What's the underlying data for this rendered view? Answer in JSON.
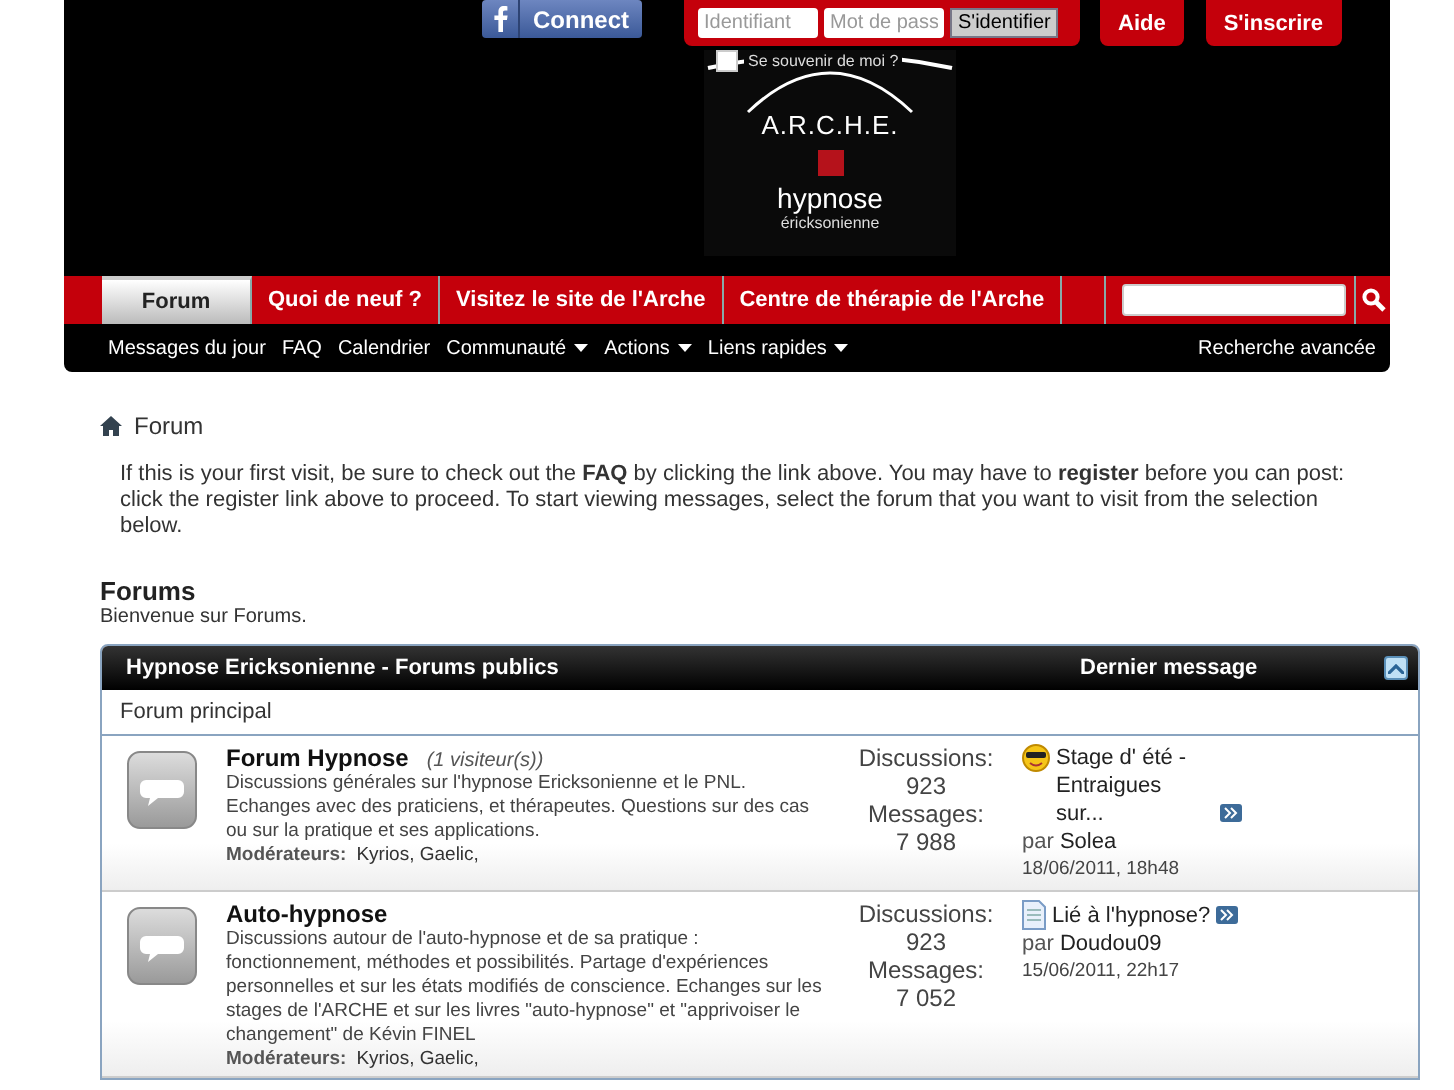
{
  "header": {
    "facebook_button": "Connect",
    "login": {
      "username_placeholder": "Identifiant",
      "password_placeholder": "Mot de pass",
      "submit": "S'identifier",
      "remember_label": "Se souvenir de moi ?",
      "remember_checked": false
    },
    "buttons": [
      "Aide",
      "S'inscrire"
    ],
    "logo": {
      "title": "A.R.C.H.E.",
      "line_1": "hypnose",
      "line_2": "éricksonienne"
    }
  },
  "nav_tabs": [
    {
      "label": "Forum",
      "selected": true
    },
    {
      "label": "Quoi de neuf ?",
      "selected": false
    },
    {
      "label": "Visitez le site de l'Arche",
      "selected": false
    },
    {
      "label": "Centre de thérapie de l'Arche",
      "selected": false
    }
  ],
  "sub_nav": [
    {
      "label": "Messages du jour",
      "dropdown": false
    },
    {
      "label": "FAQ",
      "dropdown": false
    },
    {
      "label": "Calendrier",
      "dropdown": false
    },
    {
      "label": "Communauté",
      "dropdown": true
    },
    {
      "label": "Actions",
      "dropdown": true
    },
    {
      "label": "Liens rapides",
      "dropdown": true
    }
  ],
  "advanced_search": "Recherche avancée",
  "breadcrumb": "Forum",
  "notice": "If this is your first visit, be sure to check out the **FAQ** by clicking the link above. You may have to **register** before you can post: click the register link above to proceed. To start viewing messages, select the forum that you want to visit from the selection below.",
  "forums_title": "Forums",
  "forums_subtitle": "Bienvenue sur Forums.",
  "category": {
    "title": "Hypnose Ericksonienne - Forums publics",
    "last_post_header": "Dernier message",
    "subcategory": "Forum principal"
  },
  "forums": [
    {
      "title": "Forum Hypnose",
      "visitors": "(1 visiteur(s))",
      "description": "Discussions générales sur l'hypnose Ericksonienne et le PNL. Echanges avec des praticiens, et thérapeutes. Questions sur des cas ou sur la pratique et ses applications.",
      "moderators_label": "Modérateurs:",
      "moderators": "Kyrios, Gaelic,",
      "discussions_label": "Discussions:",
      "discussions": "923",
      "messages_label": "Messages:",
      "messages": "7 988",
      "last_post": {
        "kind": "smiley",
        "title": "Stage d' été - Entraigues sur...",
        "by": "par",
        "author": "Solea",
        "date": "18/06/2011, 18h48"
      }
    },
    {
      "title": "Auto-hypnose",
      "description": "Discussions autour de l'auto-hypnose et de sa pratique : fonctionnement, méthodes et possibilités. Partage d'expériences personnelles et sur les états modifiés de conscience. Echanges sur les stages de l'ARCHE et sur les livres \"auto-hypnose\" et \"apprivoiser le changement\" de Kévin FINEL",
      "moderators_label": "Modérateurs:",
      "moderators": "Kyrios, Gaelic,",
      "discussions_label": "Discussions:",
      "discussions": "923",
      "messages_label": "Messages:",
      "messages": "7 052",
      "last_post": {
        "kind": "document",
        "title": "Lié à l'hypnose?",
        "by": "par",
        "author": "Doudou09",
        "date": "15/06/2011, 22h17"
      }
    }
  ]
}
